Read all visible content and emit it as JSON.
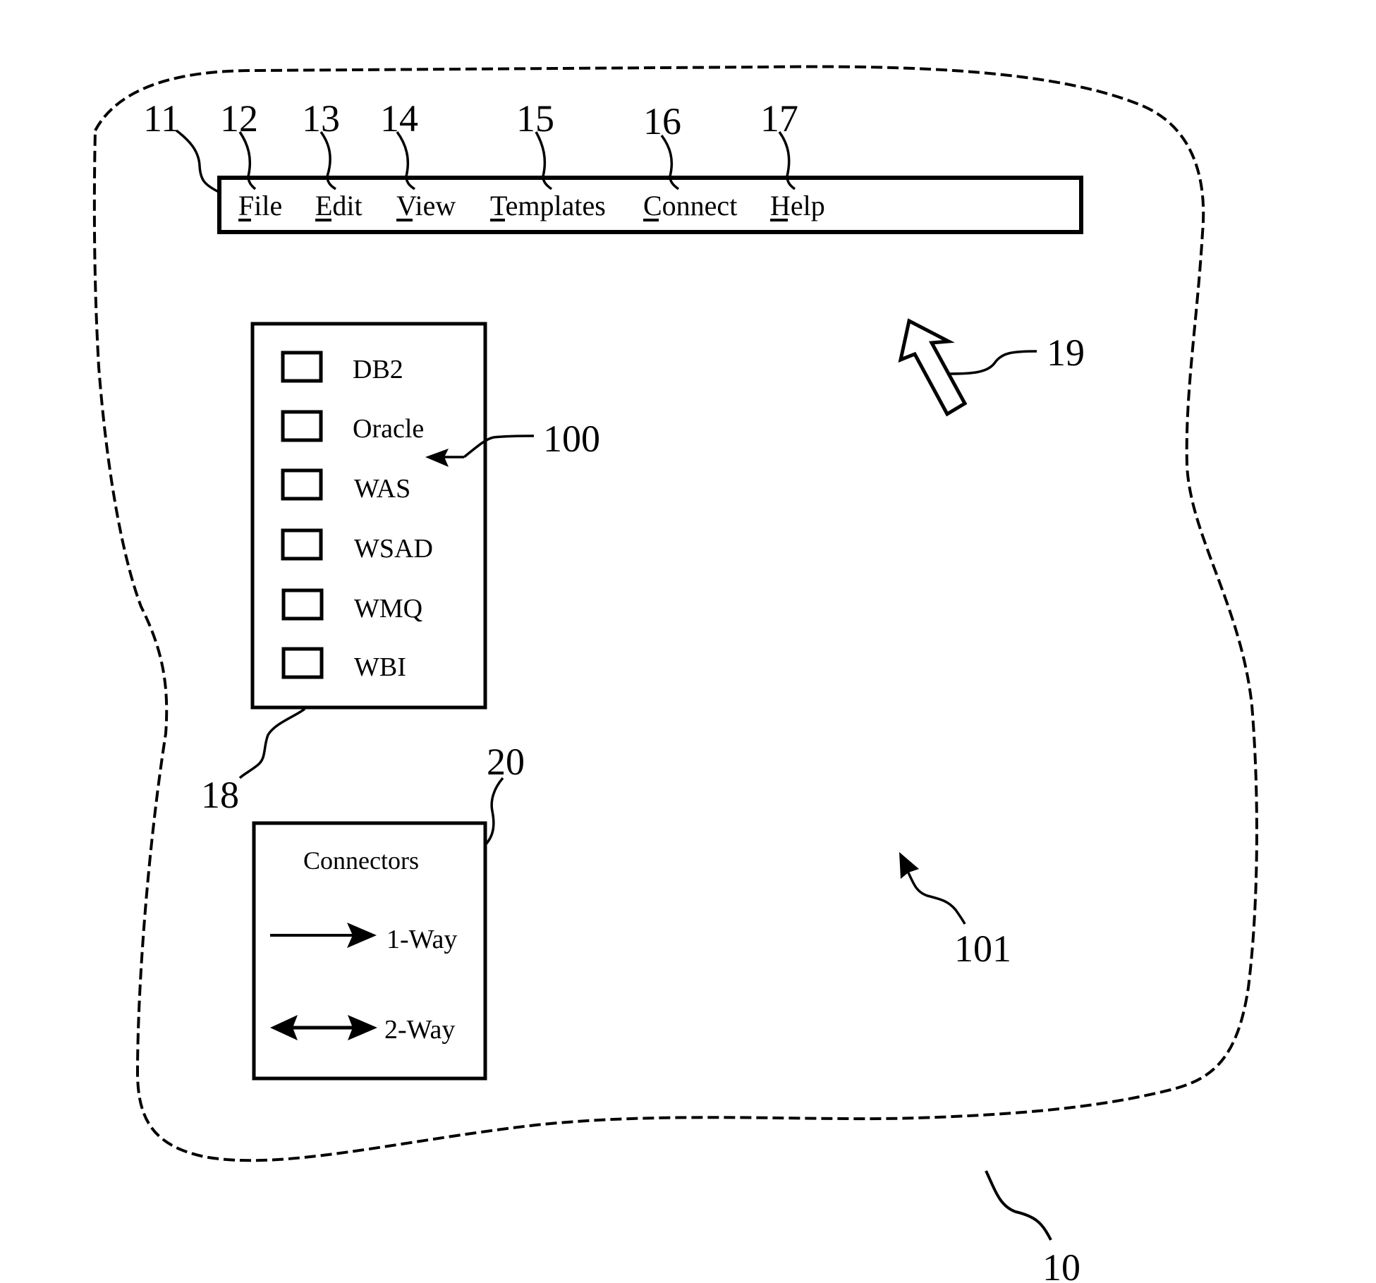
{
  "figure": {
    "window_ref": "10",
    "workspace_ref": "101"
  },
  "menu_bar": {
    "ref": "11",
    "items": [
      {
        "label": "File",
        "mnemonic": "F",
        "ref": "12"
      },
      {
        "label": "Edit",
        "mnemonic": "E",
        "ref": "13"
      },
      {
        "label": "View",
        "mnemonic": "V",
        "ref": "14"
      },
      {
        "label": "Templates",
        "mnemonic": "T",
        "ref": "15"
      },
      {
        "label": "Connect",
        "mnemonic": "C",
        "ref": "16"
      },
      {
        "label": "Help",
        "mnemonic": "H",
        "ref": "17"
      }
    ]
  },
  "palette": {
    "ref": "18",
    "item_ref": "100",
    "items": [
      {
        "label": "DB2",
        "checked": false
      },
      {
        "label": "Oracle",
        "checked": false
      },
      {
        "label": "WAS",
        "checked": false
      },
      {
        "label": "WSAD",
        "checked": false
      },
      {
        "label": "WMQ",
        "checked": false
      },
      {
        "label": "WBI",
        "checked": false
      }
    ]
  },
  "connectors": {
    "ref": "20",
    "title": "Connectors",
    "items": [
      {
        "label": "1-Way",
        "icon": "one-way-arrow-icon"
      },
      {
        "label": "2-Way",
        "icon": "two-way-arrow-icon"
      }
    ]
  },
  "cursor": {
    "ref": "19",
    "icon": "hollow-pointer-arrow-icon"
  }
}
